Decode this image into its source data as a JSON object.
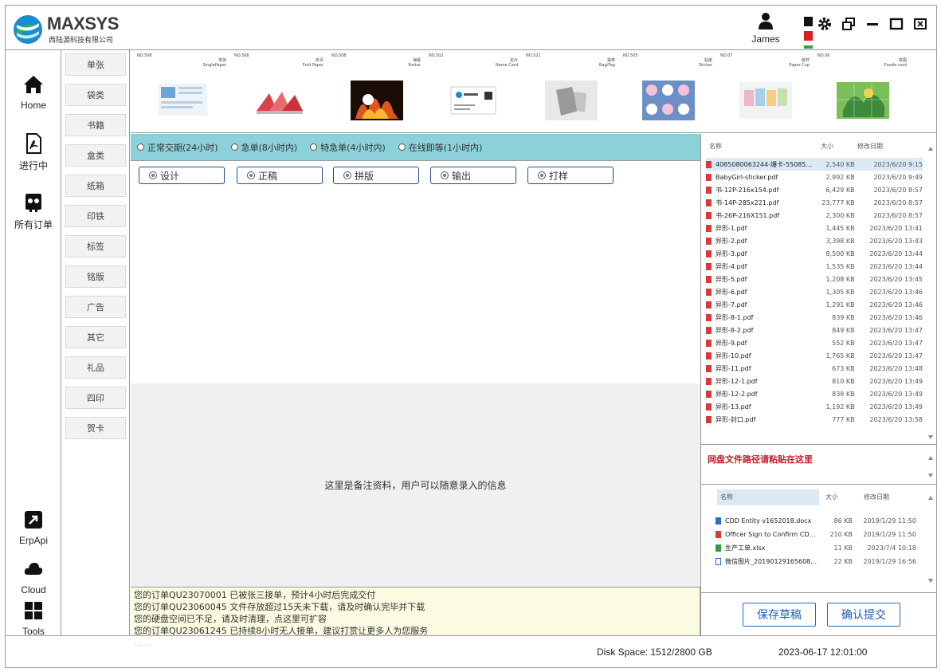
{
  "header": {
    "logo_text": "MAXSYS",
    "logo_subtitle": "西陆源科技有限公司",
    "user_name": "James",
    "colors": {
      "brand_blue": "#1c8bd0",
      "brand_green": "#2fae5a",
      "status_red": "#d92020",
      "status_green": "#3aa040"
    }
  },
  "leftnav": [
    {
      "label": "Home",
      "icon": "home-icon"
    },
    {
      "label": "进行中",
      "icon": "pdf-icon"
    },
    {
      "label": "所有订单",
      "icon": "orders-icon"
    },
    {
      "label": "ErpApi",
      "icon": "external-link-icon"
    },
    {
      "label": "Cloud",
      "icon": "cloud-icon"
    },
    {
      "label": "Tools",
      "icon": "grid-icon"
    }
  ],
  "categories": [
    "单张",
    "袋类",
    "书籍",
    "盒类",
    "纸箱",
    "印铁",
    "标签",
    "铭版",
    "广告",
    "其它",
    "礼品",
    "四印",
    "贺卡"
  ],
  "products": [
    {
      "no": "NO.508",
      "name": "单张",
      "name_en": "SinglePaper"
    },
    {
      "no": "NO.508",
      "name": "折页",
      "name_en": "Fold Paper"
    },
    {
      "no": "NO.508",
      "name": "海报",
      "name_en": "Poster"
    },
    {
      "no": "NO.502",
      "name": "名片",
      "name_en": "Name Card"
    },
    {
      "no": "NO.521",
      "name": "袋类",
      "name_en": "Bag/Fag"
    },
    {
      "no": "NO.505",
      "name": "贴纸",
      "name_en": "Sticker"
    },
    {
      "no": "NO.07",
      "name": "纸杯",
      "name_en": "Paper Cup"
    },
    {
      "no": "NO.06",
      "name": "拼图",
      "name_en": "Puzzle card"
    }
  ],
  "urgency": [
    "正常交期(24小时)",
    "急单(8小时内)",
    "特急单(4小时内)",
    "在线即等(1小时内)"
  ],
  "stages": [
    "设计",
    "正稿",
    "拼版",
    "输出",
    "打样"
  ],
  "note_placeholder": "这里是备注资料，用户可以随意录入的信息",
  "messages": [
    "您的订单QU23070001 已被张三接单，预计4小时后完成交付",
    "您的订单QU23060045 文件存放超过15天未下载，请及时确认完毕并下载",
    "您的硬盘空间已不足，请及时清理，点这里可扩容",
    "您的订单QU23061245 已持续8小时无人接单，建议打赏让更多人为您服务",
    "……"
  ],
  "files_header": {
    "name": "名称",
    "size": "大小",
    "date": "修改日期"
  },
  "files": [
    {
      "name": "4085080063244-爆卡-55085…",
      "size": "2,540 KB",
      "date": "2023/6/20 9:15"
    },
    {
      "name": "BabyGirl-sticker.pdf",
      "size": "2,992 KB",
      "date": "2023/6/20 9:49"
    },
    {
      "name": "书-12P-216x154.pdf",
      "size": "6,429 KB",
      "date": "2023/6/20 8:57"
    },
    {
      "name": "书-14P-285x221.pdf",
      "size": "23,777 KB",
      "date": "2023/6/20 8:57"
    },
    {
      "name": "书-26P-216X151.pdf",
      "size": "2,300 KB",
      "date": "2023/6/20 8:57"
    },
    {
      "name": "异形-1.pdf",
      "size": "1,445 KB",
      "date": "2023/6/20 13:41"
    },
    {
      "name": "异形-2.pdf",
      "size": "3,398 KB",
      "date": "2023/6/20 13:43"
    },
    {
      "name": "异形-3.pdf",
      "size": "8,500 KB",
      "date": "2023/6/20 13:44"
    },
    {
      "name": "异形-4.pdf",
      "size": "1,535 KB",
      "date": "2023/6/20 13:44"
    },
    {
      "name": "异形-5.pdf",
      "size": "1,208 KB",
      "date": "2023/6/20 13:45"
    },
    {
      "name": "异形-6.pdf",
      "size": "1,305 KB",
      "date": "2023/6/20 13:46"
    },
    {
      "name": "异形-7.pdf",
      "size": "1,291 KB",
      "date": "2023/6/20 13:46"
    },
    {
      "name": "异形-8-1.pdf",
      "size": "839 KB",
      "date": "2023/6/20 13:46"
    },
    {
      "name": "异形-8-2.pdf",
      "size": "849 KB",
      "date": "2023/6/20 13:47"
    },
    {
      "name": "异形-9.pdf",
      "size": "552 KB",
      "date": "2023/6/20 13:47"
    },
    {
      "name": "异形-10.pdf",
      "size": "1,765 KB",
      "date": "2023/6/20 13:47"
    },
    {
      "name": "异形-11.pdf",
      "size": "673 KB",
      "date": "2023/6/20 13:48"
    },
    {
      "name": "异形-12-1.pdf",
      "size": "810 KB",
      "date": "2023/6/20 13:49"
    },
    {
      "name": "异形-12-2.pdf",
      "size": "838 KB",
      "date": "2023/6/20 13:49"
    },
    {
      "name": "异形-13.pdf",
      "size": "1,192 KB",
      "date": "2023/6/20 13:49"
    },
    {
      "name": "异形-封口.pdf",
      "size": "777 KB",
      "date": "2023/6/20 13:58"
    }
  ],
  "path_prompt": "网盘文件路径请粘贴在这里",
  "attachments": [
    {
      "name": "CDD Entity v1652018.docx",
      "size": "86 KB",
      "date": "2019/1/29 11:50",
      "type": "word"
    },
    {
      "name": "Officer Sign to Confirm CD…",
      "size": "210 KB",
      "date": "2019/1/29 11:50",
      "type": "pdf"
    },
    {
      "name": "生产工单.xlsx",
      "size": "11 KB",
      "date": "2023/7/4 10:18",
      "type": "excel"
    },
    {
      "name": "微信图片_20190129165608…",
      "size": "22 KB",
      "date": "2019/1/29 16:56",
      "type": "image"
    }
  ],
  "buttons": {
    "save_draft": "保存草稿",
    "confirm_submit": "确认提交"
  },
  "status": {
    "disk_space": "Disk Space: 1512/2800 GB",
    "datetime": "2023-06-17 12:01:00"
  }
}
